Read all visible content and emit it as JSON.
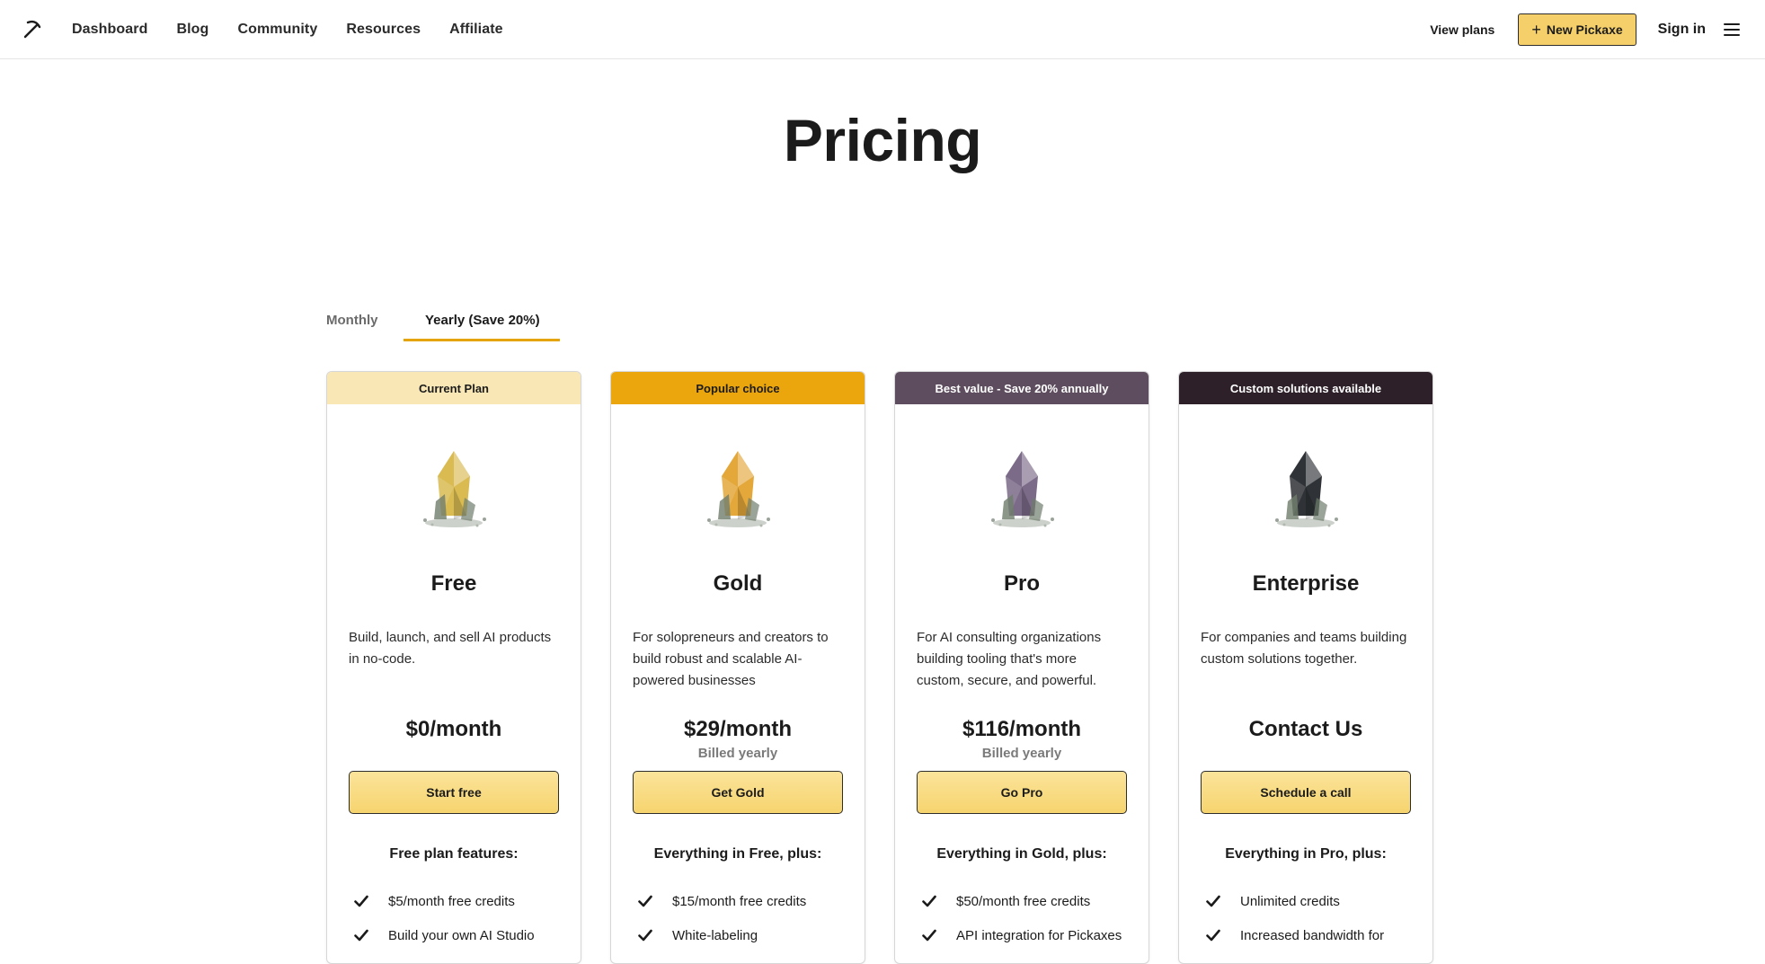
{
  "nav": {
    "links": [
      "Dashboard",
      "Blog",
      "Community",
      "Resources",
      "Affiliate"
    ],
    "view_plans": "View plans",
    "new_pickaxe": "New Pickaxe",
    "sign_in": "Sign in"
  },
  "page": {
    "title": "Pricing"
  },
  "billing_tabs": {
    "monthly": "Monthly",
    "yearly": "Yearly (Save 20%)",
    "selected": "yearly"
  },
  "plans": [
    {
      "banner": "Current Plan",
      "banner_bg": "#f9e7b6",
      "banner_color": "#1b1b1b",
      "gem_color": "#d9bb52",
      "name": "Free",
      "description": "Build, launch, and sell AI products in no-code.",
      "price": "$0/month",
      "billing": "",
      "cta": "Start free",
      "features_heading": "Free plan features:",
      "features": [
        "$5/month free credits",
        "Build your own AI Studio"
      ]
    },
    {
      "banner": "Popular choice",
      "banner_bg": "#eba60d",
      "banner_color": "#1b1b1b",
      "gem_color": "#e3a73a",
      "name": "Gold",
      "description": "For solopreneurs and creators to build robust and scalable AI-powered businesses",
      "price": "$29/month",
      "billing": "Billed yearly",
      "cta": "Get Gold",
      "features_heading": "Everything in Free, plus:",
      "features": [
        "$15/month free credits",
        "White-labeling"
      ]
    },
    {
      "banner": "Best value - Save 20% annually",
      "banner_bg": "#5e4d5e",
      "banner_color": "#ffffff",
      "gem_color": "#7b6a88",
      "name": "Pro",
      "description": "For AI consulting organizations building tooling that's more custom, secure, and powerful.",
      "price": "$116/month",
      "billing": "Billed yearly",
      "cta": "Go Pro",
      "features_heading": "Everything in Gold, plus:",
      "features": [
        "$50/month free credits",
        "API integration for Pickaxes"
      ]
    },
    {
      "banner": "Custom solutions available",
      "banner_bg": "#2d2029",
      "banner_color": "#ffffff",
      "gem_color": "#2f3236",
      "name": "Enterprise",
      "description": "For companies and teams building custom solutions together.",
      "price": "Contact Us",
      "billing": "",
      "cta": "Schedule a call",
      "features_heading": "Everything in Pro, plus:",
      "features": [
        "Unlimited credits",
        "Increased bandwidth for"
      ]
    }
  ]
}
